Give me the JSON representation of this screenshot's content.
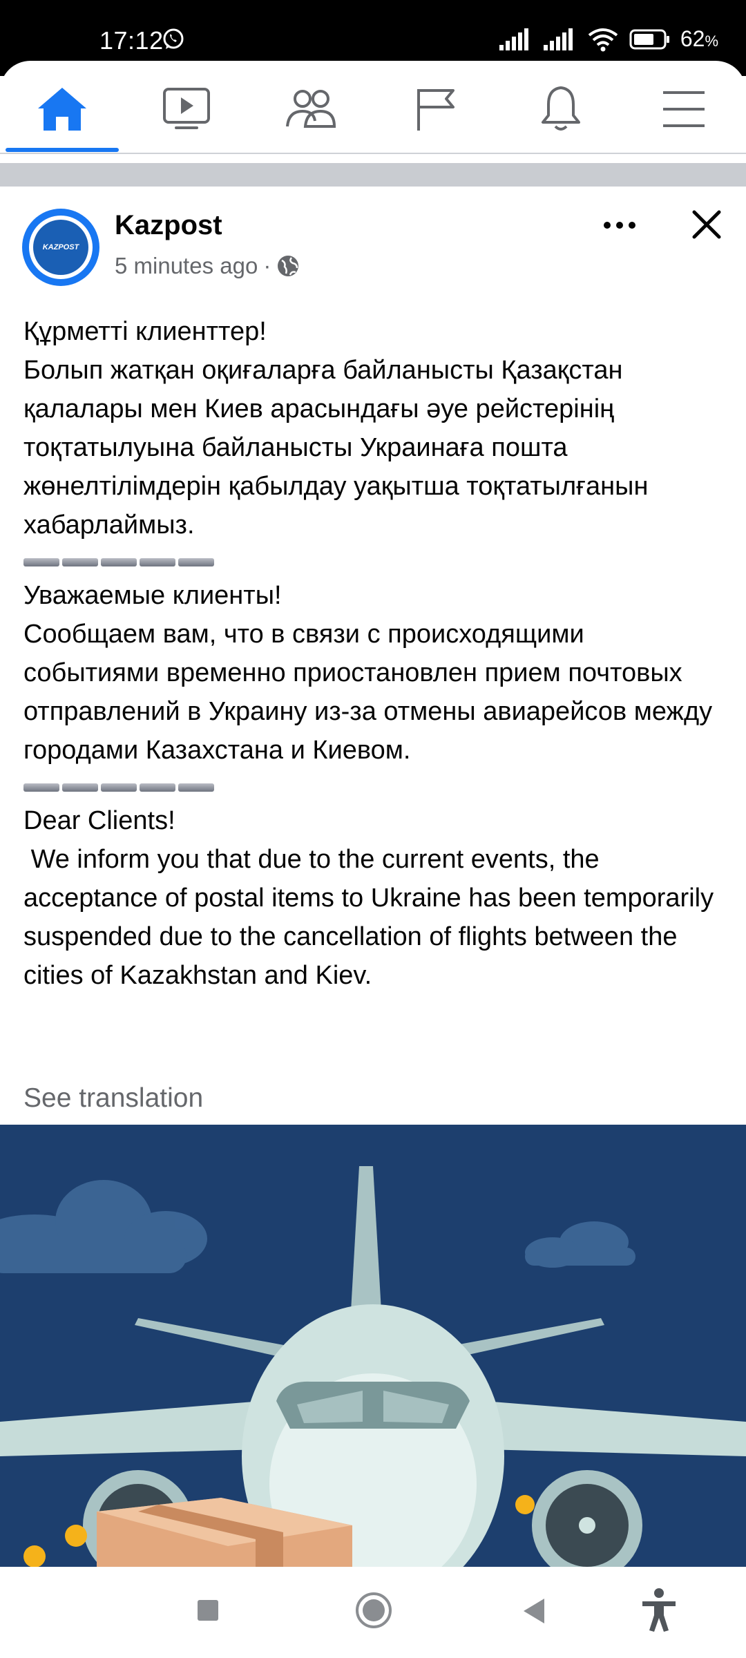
{
  "status_bar": {
    "time": "17:12",
    "battery": "62",
    "battery_unit": "%",
    "icons": [
      "whatsapp-icon",
      "signal-icon",
      "signal-icon",
      "wifi-icon",
      "battery-icon"
    ]
  },
  "nav": {
    "items": [
      "home-icon",
      "video-icon",
      "friends-icon",
      "pages-flag-icon",
      "notifications-bell-icon",
      "menu-icon"
    ],
    "active": "home",
    "accent": "#1877f2"
  },
  "post": {
    "page_name": "Kazpost",
    "avatar_text": "KAZPOST",
    "time": "5 minutes ago",
    "separator": "·",
    "privacy_icon": "globe-icon",
    "kazakh": [
      "Құрметті клиенттер!",
      "Болып жатқан оқиғаларға байланысты Қазақстан қалалары мен Киев арасындағы әуе рейстерінің тоқтатылуына байланысты Украинаға пошта жөнелтілімдерін қабылдау уақытша тоқтатылғанын хабарлаймыз."
    ],
    "russian": [
      "Уважаемые клиенты!",
      "Сообщаем вам, что в связи с происходящими событиями временно приостановлен прием почтовых отправлений в Украину из-за отмены авиарейсов между городами Казахстана и Киевом."
    ],
    "english": [
      "Dear Clients!",
      " We inform you that due to the current events, the acceptance of postal items to Ukraine has been temporarily suspended due to the cancellation of flights between the cities of Kazakhstan and Kiev."
    ],
    "see_translation": "See translation"
  },
  "colors": {
    "text": "#050505",
    "secondary": "#65676b",
    "image_bg": "#1d3f6e"
  }
}
